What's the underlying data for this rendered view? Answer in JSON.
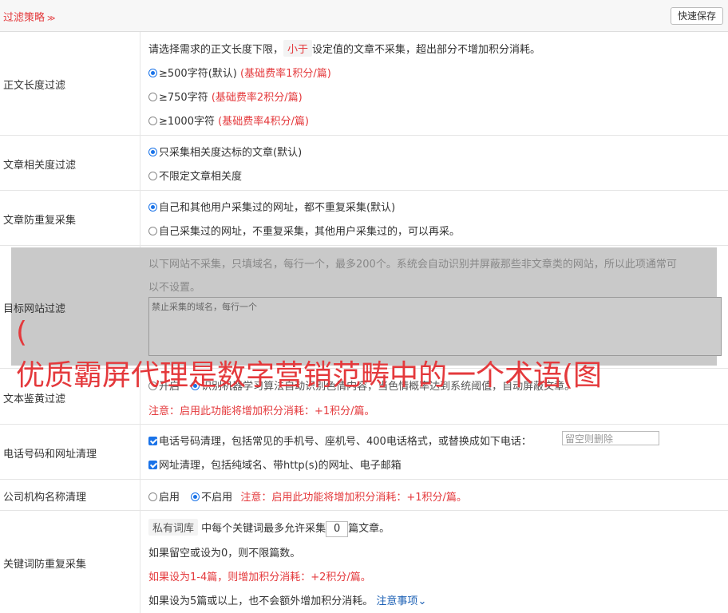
{
  "header": {
    "title": "过滤策略",
    "title_icon": "chevron-double-down-icon",
    "save_label": "快速保存"
  },
  "length_filter": {
    "label": "正文长度过滤",
    "desc_pre": "请选择需求的正文长度下限，",
    "desc_tag": "小于",
    "desc_post": "设定值的文章不采集，超出部分不增加积分消耗。",
    "options": [
      {
        "label": "≥500字符(默认)",
        "note": "(基础费率1积分/篇)"
      },
      {
        "label": "≥750字符",
        "note": "(基础费率2积分/篇)"
      },
      {
        "label": "≥1000字符",
        "note": "(基础费率4积分/篇)"
      }
    ]
  },
  "relevance_filter": {
    "label": "文章相关度过滤",
    "options": [
      "只采集相关度达标的文章(默认)",
      "不限定文章相关度"
    ]
  },
  "duplicate_filter": {
    "label": "文章防重复采集",
    "options": [
      "自己和其他用户采集过的网址，都不重复采集(默认)",
      "自己采集过的网址，不重复采集，其他用户采集过的，可以再采。"
    ]
  },
  "site_filter": {
    "label": "目标网站过滤",
    "desc_line1": "以下网站不采集，只填域名，每行一个，最多200个。系统会自动识别并屏蔽那些非文章类的网站，所以此项通常可",
    "desc_line2": "以不设置。",
    "textarea_placeholder": "禁止采集的域名，每行一个"
  },
  "overlay_text": {
    "line1": "(",
    "line2": "优质霸屏代理是数字营销范畴中的一个术语(图"
  },
  "porn_filter": {
    "label": "文本鉴黄过滤",
    "option_on": "开启",
    "desc": "识别机器学习算法自动识别色情内容，当色情概率达到系统阈值，自动屏蔽文章。",
    "notice": "注意：启用此功能将增加积分消耗：+1积分/篇。"
  },
  "contact_clean": {
    "label": "电话号码和网址清理",
    "phone_label": "电话号码清理，包括常见的手机号、座机号、400电话格式，或替换成如下电话：",
    "phone_placeholder": "留空则删除",
    "url_label": "网址清理，包括纯域名、带http(s)的网址、电子邮箱"
  },
  "org_clean": {
    "label": "公司机构名称清理",
    "on": "启用",
    "off": "不启用",
    "notice": "注意：启用此功能将增加积分消耗：+1积分/篇。"
  },
  "keyword_dup": {
    "label": "关键词防重复采集",
    "tag": "私有词库",
    "text_pre": "中每个关键词最多允许采集",
    "value": "0",
    "text_post": "篇文章。",
    "line2": "如果留空或设为0，则不限篇数。",
    "line3": "如果设为1-4篇，则增加积分消耗：+2积分/篇。",
    "line4": "如果设为5篇或以上，也不会额外增加积分消耗。",
    "notice_link": "注意事项"
  }
}
